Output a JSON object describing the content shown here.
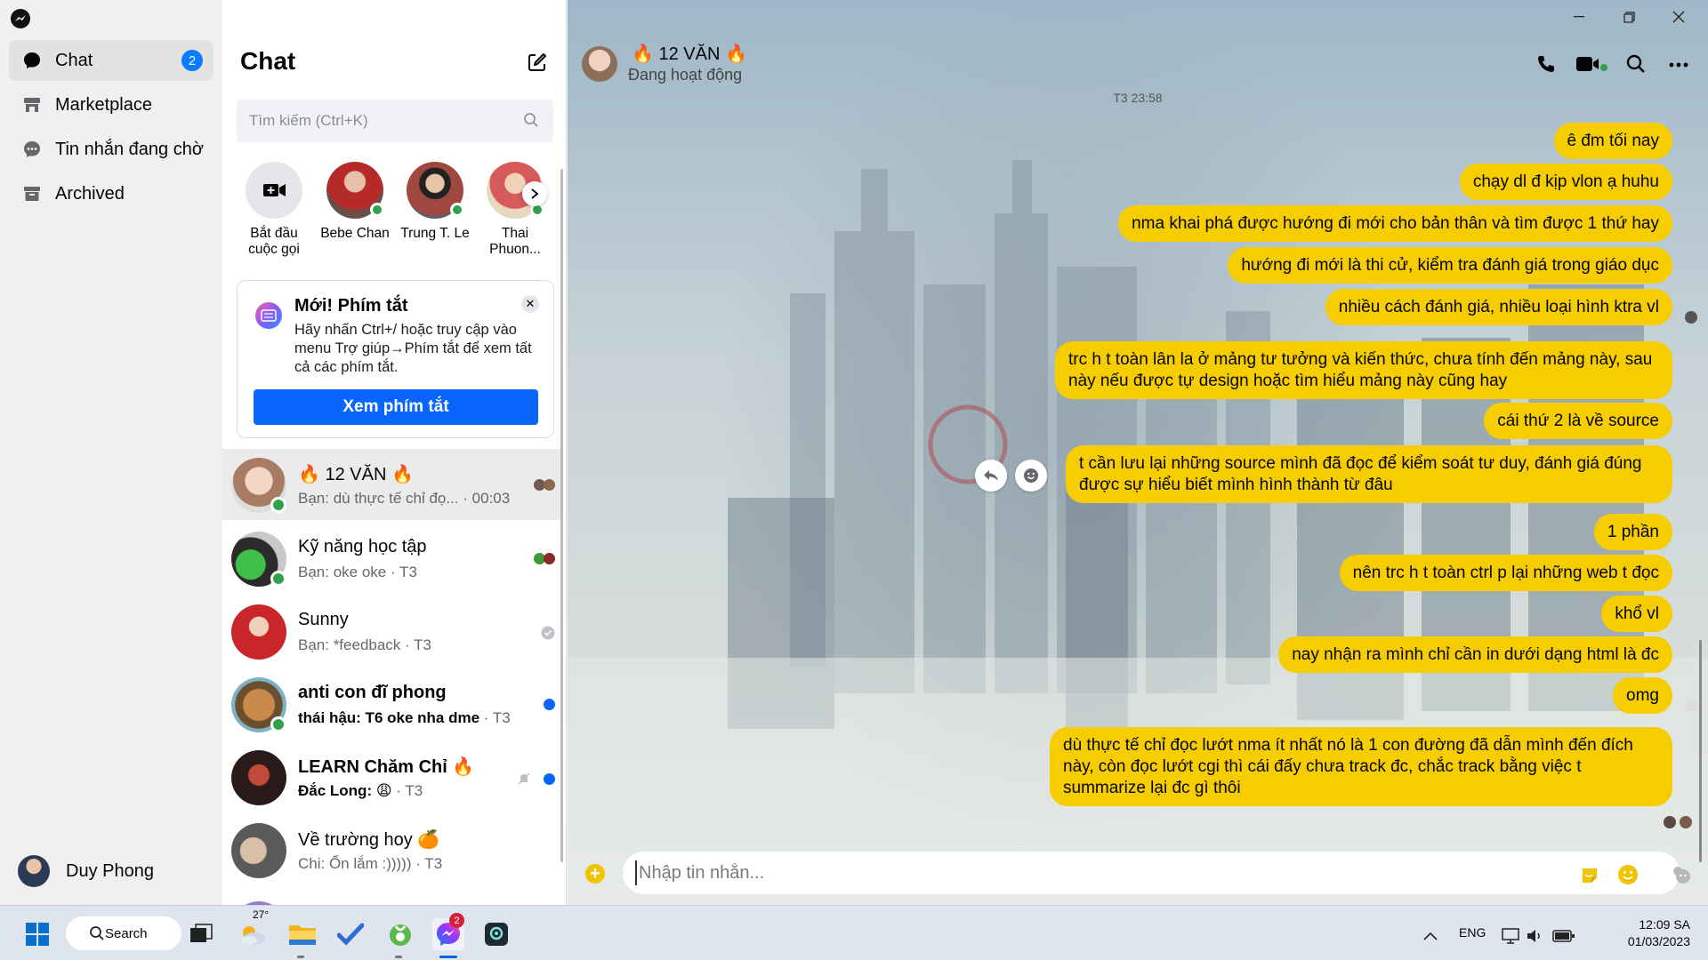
{
  "nav": {
    "items": [
      {
        "label": "Chat",
        "badge": "2",
        "icon": "chat-bubble-icon"
      },
      {
        "label": "Marketplace",
        "icon": "marketplace-icon"
      },
      {
        "label": "Tin nhắn đang chờ",
        "icon": "pending-messages-icon"
      },
      {
        "label": "Archived",
        "icon": "archive-icon"
      }
    ],
    "profile_name": "Duy Phong"
  },
  "list": {
    "title": "Chat",
    "search_placeholder": "Tìm kiếm (Ctrl+K)",
    "stories": [
      {
        "label": "Bắt đầu cuộc gọi"
      },
      {
        "label": "Bebe Chan"
      },
      {
        "label": "Trung T. Le"
      },
      {
        "label": "Thai Phuon..."
      }
    ],
    "tip": {
      "title": "Mới! Phím tắt",
      "body": "Hãy nhấn Ctrl+/ hoặc truy cập vào menu Trợ giúp→Phím tắt để xem tất cả các phím tắt.",
      "button": "Xem phím tắt"
    },
    "conversations": [
      {
        "name": "🔥 12 VĂN 🔥",
        "preview": "Bạn: dù thực tế chỉ đọ...",
        "time": "· 00:03",
        "selected": true
      },
      {
        "name": "Kỹ năng học tập",
        "preview": "Bạn: oke oke",
        "time": "· T3"
      },
      {
        "name": "Sunny",
        "preview": "Bạn: *feedback",
        "time": "· T3"
      },
      {
        "name": "anti con đĩ phong",
        "preview": "thái hậu: T6 oke nha dme",
        "time": "· T3",
        "unread": true
      },
      {
        "name": "LEARN Chăm Chỉ 🔥",
        "preview": "Đắc Long: 😩",
        "time": "· T3",
        "unread": true,
        "muted": true
      },
      {
        "name": "Về trường hoy 🍊",
        "preview": "Chi: Ổn lắm :)))))",
        "time": "· T3"
      }
    ]
  },
  "chat": {
    "name": "🔥 12 VĂN 🔥",
    "status": "Đang hoạt động",
    "timestamp": "T3 23:58",
    "messages": [
      "ê đm tối nay",
      "chạy dl đ kịp vlon ạ huhu",
      "nma khai phá được hướng đi mới cho bản thân và tìm được 1 thứ hay",
      "hướng đi mới là thi cử, kiểm tra đánh giá trong giáo dục",
      "nhiều cách đánh giá, nhiều loại hình ktra vl",
      "trc h t toàn lân la ở mảng tư tưởng và kiến thức, chưa tính đến mảng này, sau này nếu được tự design hoặc tìm hiểu mảng này cũng hay",
      "cái thứ 2 là về source",
      "t cần lưu lại những source mình đã đọc để kiểm soát tư duy, đánh giá đúng được sự hiểu biết mình hình thành từ đâu",
      "1 phần",
      "nên trc h t toàn ctrl p lại những web t đọc",
      "khổ vl",
      "nay nhận ra mình chỉ cần in dưới dạng html là đc",
      "omg",
      "dù thực tế chỉ đọc lướt nma ít nhất nó là 1 con đường đã dẫn mình đến đích này, còn đọc lướt cgi thì cái đấy chưa track đc, chắc track bằng việc t summarize lại đc gì thôi"
    ],
    "composer_placeholder": "Nhập tin nhắn...",
    "bubble_color": "#f5cd00"
  },
  "taskbar": {
    "search_label": "Search",
    "weather_temp": "27°",
    "messenger_badge": "2",
    "language": "ENG",
    "time": "12:09 SA",
    "date": "01/03/2023"
  }
}
